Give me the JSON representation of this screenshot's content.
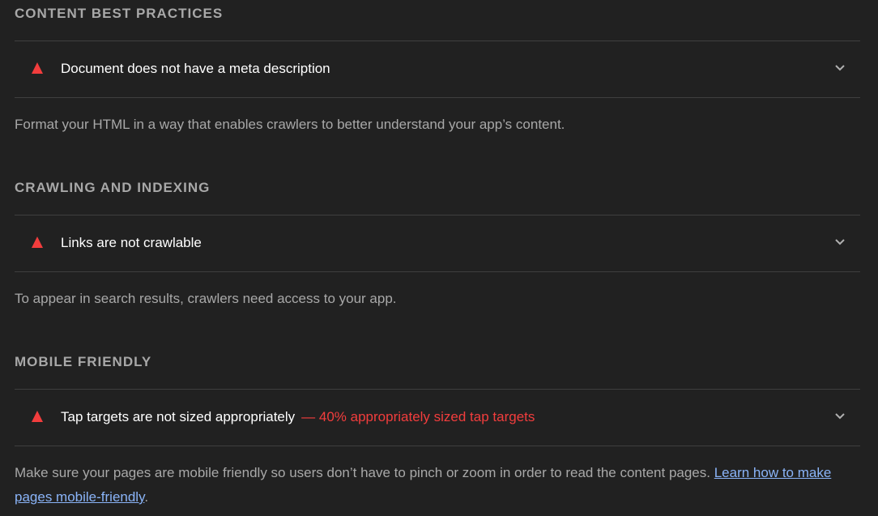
{
  "colors": {
    "background": "#212121",
    "fail": "#f23d3d",
    "link": "#8ab4f8",
    "divider": "#3f3f3f"
  },
  "groups": [
    {
      "title": "CONTENT BEST PRACTICES",
      "audit": {
        "icon": "fail-triangle-icon",
        "title": "Document does not have a meta description",
        "display_value": ""
      },
      "description": "Format your HTML in a way that enables crawlers to better understand your app’s content."
    },
    {
      "title": "CRAWLING AND INDEXING",
      "audit": {
        "icon": "fail-triangle-icon",
        "title": "Links are not crawlable",
        "display_value": ""
      },
      "description": "To appear in search results, crawlers need access to your app."
    },
    {
      "title": "MOBILE FRIENDLY",
      "audit": {
        "icon": "fail-triangle-icon",
        "title": "Tap targets are not sized appropriately",
        "display_value": "— 40% appropriately sized tap targets"
      },
      "description": "Make sure your pages are mobile friendly so users don’t have to pinch or zoom in order to read the content pages.",
      "link_text": "Learn how to make pages mobile-friendly",
      "trailing": "."
    }
  ]
}
